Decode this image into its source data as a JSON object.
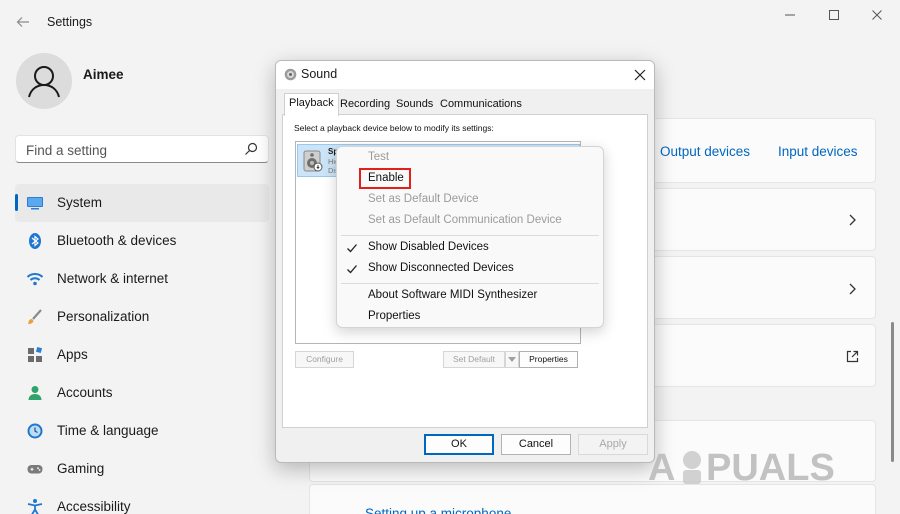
{
  "window": {
    "title": "Settings",
    "back_icon": "back-arrow-icon",
    "controls": [
      "minimize-icon",
      "maximize-icon",
      "close-icon"
    ]
  },
  "profile": {
    "name": "Aimee",
    "avatar_icon": "person-icon"
  },
  "search": {
    "placeholder": "Find a setting",
    "icon": "search-icon"
  },
  "sidebar": {
    "items": [
      {
        "label": "System",
        "icon": "system-icon",
        "active": true
      },
      {
        "label": "Bluetooth & devices",
        "icon": "bluetooth-icon"
      },
      {
        "label": "Network & internet",
        "icon": "wifi-icon"
      },
      {
        "label": "Personalization",
        "icon": "brush-icon"
      },
      {
        "label": "Apps",
        "icon": "apps-icon"
      },
      {
        "label": "Accounts",
        "icon": "accounts-icon"
      },
      {
        "label": "Time & language",
        "icon": "time-language-icon"
      },
      {
        "label": "Gaming",
        "icon": "gaming-icon"
      },
      {
        "label": "Accessibility",
        "icon": "accessibility-icon"
      }
    ]
  },
  "main": {
    "output_devices_link": "Output devices",
    "input_devices_link": "Input devices",
    "partial_link": "Setting up a microphone"
  },
  "dialog": {
    "title": "Sound",
    "tabs": [
      "Playback",
      "Recording",
      "Sounds",
      "Communications"
    ],
    "active_tab": "Playback",
    "instruction": "Select a playback device below to modify its settings:",
    "device": {
      "name": "Spe",
      "description": "Hig",
      "status": "Dis"
    },
    "buttons": {
      "configure": "Configure",
      "set_default": "Set Default",
      "properties": "Properties",
      "ok": "OK",
      "cancel": "Cancel",
      "apply": "Apply"
    }
  },
  "context_menu": {
    "items": [
      {
        "label": "Test",
        "disabled": true
      },
      {
        "label": "Enable",
        "highlighted": true
      },
      {
        "label": "Set as Default Device",
        "disabled": true
      },
      {
        "label": "Set as Default Communication Device",
        "disabled": true
      },
      {
        "label": "Show Disabled Devices",
        "checked": true
      },
      {
        "label": "Show Disconnected Devices",
        "checked": true
      },
      {
        "label": "About Software MIDI Synthesizer"
      },
      {
        "label": "Properties"
      }
    ],
    "highlight_color": "#e0201b"
  },
  "watermark": {
    "text": "PUALS",
    "letter": "A"
  },
  "colors": {
    "accent": "#0067c0",
    "background": "#f3f3f3"
  }
}
